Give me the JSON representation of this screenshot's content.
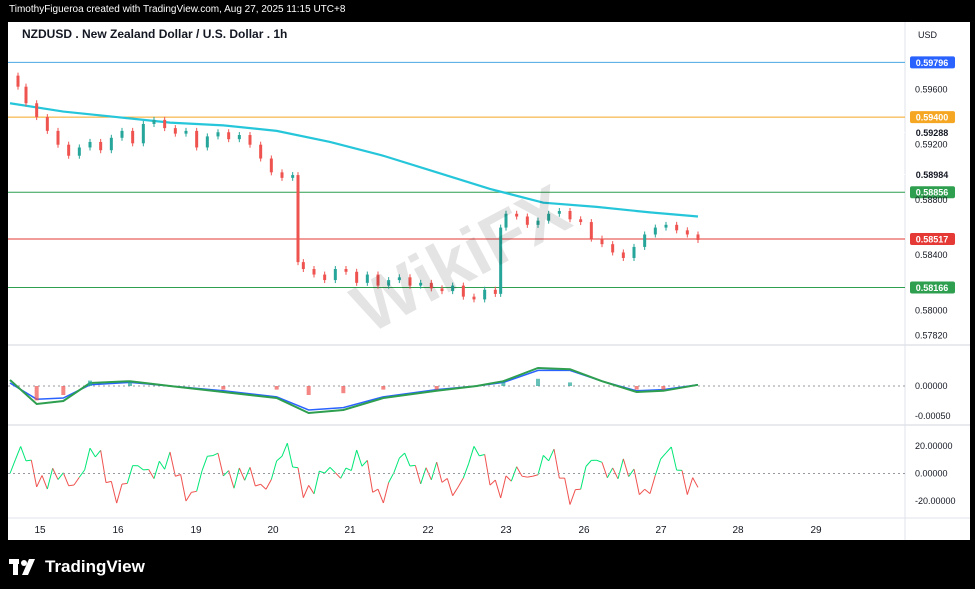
{
  "header": {
    "credit": "TimothyFigueroa created with TradingView.com, Aug 27, 2025 11:15 UTC+8"
  },
  "footer": {
    "brand": "TradingView"
  },
  "watermark": {
    "text": "WikiFX"
  },
  "chart_data": {
    "type": "line",
    "title": "NZDUSD . New Zealand Dollar / U.S. Dollar . 1h",
    "currency": "USD",
    "x_labels": [
      "15",
      "16",
      "19",
      "20",
      "21",
      "22",
      "23",
      "26",
      "27",
      "28",
      "29"
    ],
    "price_ticks": [
      "0.59600",
      "0.59200",
      "0.58800",
      "0.58400",
      "0.58000",
      "0.57820"
    ],
    "horizontal_levels": [
      {
        "value": "0.59796",
        "color": "#2962ff",
        "line": "#4aa8e0"
      },
      {
        "value": "0.59400",
        "color": "#f5a623",
        "line": "#f5a623"
      },
      {
        "value": "0.59288",
        "color": "#ffffff",
        "line": "#ffffff"
      },
      {
        "value": "0.58984",
        "color": "#ffffff",
        "line": "#ffffff"
      },
      {
        "value": "0.58856",
        "color": "#2e9e4f",
        "line": "#2e9e4f"
      },
      {
        "value": "0.58528",
        "color": "#ffffff",
        "line": "#ffffff"
      },
      {
        "value": "0.58517",
        "color": "#e53935",
        "line": "#e53935"
      },
      {
        "value": "0.58166",
        "color": "#2e9e4f",
        "line": "#2e9e4f"
      }
    ],
    "price_path": [
      [
        0,
        0.597
      ],
      [
        3,
        0.5962
      ],
      [
        6,
        0.595
      ],
      [
        10,
        0.594
      ],
      [
        14,
        0.593
      ],
      [
        18,
        0.592
      ],
      [
        22,
        0.5912
      ],
      [
        26,
        0.5918
      ],
      [
        30,
        0.5922
      ],
      [
        34,
        0.5916
      ],
      [
        38,
        0.5925
      ],
      [
        42,
        0.593
      ],
      [
        46,
        0.5921
      ],
      [
        50,
        0.5935
      ],
      [
        54,
        0.5938
      ],
      [
        58,
        0.5932
      ],
      [
        62,
        0.5928
      ],
      [
        66,
        0.593
      ],
      [
        70,
        0.5918
      ],
      [
        74,
        0.5926
      ],
      [
        78,
        0.5929
      ],
      [
        82,
        0.5924
      ],
      [
        86,
        0.5927
      ],
      [
        90,
        0.592
      ],
      [
        94,
        0.591
      ],
      [
        98,
        0.59
      ],
      [
        102,
        0.5896
      ],
      [
        106,
        0.5898
      ],
      [
        108,
        0.5835
      ],
      [
        110,
        0.583
      ],
      [
        114,
        0.5826
      ],
      [
        118,
        0.5822
      ],
      [
        122,
        0.583
      ],
      [
        126,
        0.5828
      ],
      [
        130,
        0.582
      ],
      [
        134,
        0.5826
      ],
      [
        138,
        0.5818
      ],
      [
        142,
        0.5822
      ],
      [
        146,
        0.5824
      ],
      [
        150,
        0.5818
      ],
      [
        154,
        0.582
      ],
      [
        158,
        0.5816
      ],
      [
        162,
        0.5814
      ],
      [
        166,
        0.5818
      ],
      [
        170,
        0.581
      ],
      [
        174,
        0.5808
      ],
      [
        178,
        0.5815
      ],
      [
        182,
        0.5812
      ],
      [
        184,
        0.586
      ],
      [
        186,
        0.587
      ],
      [
        190,
        0.5868
      ],
      [
        194,
        0.5862
      ],
      [
        198,
        0.5865
      ],
      [
        202,
        0.587
      ],
      [
        206,
        0.5872
      ],
      [
        210,
        0.5866
      ],
      [
        214,
        0.5864
      ],
      [
        218,
        0.5852
      ],
      [
        222,
        0.5848
      ],
      [
        226,
        0.5842
      ],
      [
        230,
        0.5838
      ],
      [
        234,
        0.5846
      ],
      [
        238,
        0.5855
      ],
      [
        242,
        0.586
      ],
      [
        246,
        0.5862
      ],
      [
        250,
        0.5858
      ],
      [
        254,
        0.5855
      ],
      [
        258,
        0.5851
      ]
    ],
    "ma_path": [
      [
        0,
        0.595
      ],
      [
        20,
        0.5944
      ],
      [
        40,
        0.594
      ],
      [
        60,
        0.5936
      ],
      [
        80,
        0.5934
      ],
      [
        100,
        0.593
      ],
      [
        120,
        0.5922
      ],
      [
        140,
        0.5912
      ],
      [
        160,
        0.59
      ],
      [
        180,
        0.5888
      ],
      [
        200,
        0.5878
      ],
      [
        220,
        0.5875
      ],
      [
        240,
        0.5871
      ],
      [
        258,
        0.5868
      ]
    ],
    "macd": {
      "ticks": [
        "0.00000",
        "-0.00050"
      ],
      "fast": [
        [
          0,
          0.0001
        ],
        [
          10,
          -0.0003
        ],
        [
          20,
          -0.00025
        ],
        [
          30,
          5e-05
        ],
        [
          45,
          8e-05
        ],
        [
          60,
          0.0
        ],
        [
          80,
          -0.0001
        ],
        [
          100,
          -0.0002
        ],
        [
          112,
          -0.00045
        ],
        [
          125,
          -0.0004
        ],
        [
          140,
          -0.0002
        ],
        [
          160,
          -8e-05
        ],
        [
          175,
          0.0
        ],
        [
          185,
          8e-05
        ],
        [
          198,
          0.0003
        ],
        [
          210,
          0.00028
        ],
        [
          222,
          8e-05
        ],
        [
          235,
          -0.0001
        ],
        [
          245,
          -8e-05
        ],
        [
          258,
          2e-05
        ]
      ],
      "slow": [
        [
          0,
          5e-05
        ],
        [
          10,
          -0.00022
        ],
        [
          20,
          -0.0002
        ],
        [
          30,
          2e-05
        ],
        [
          45,
          6e-05
        ],
        [
          60,
          0.0
        ],
        [
          80,
          -8e-05
        ],
        [
          100,
          -0.00018
        ],
        [
          112,
          -0.0004
        ],
        [
          125,
          -0.00036
        ],
        [
          140,
          -0.00018
        ],
        [
          160,
          -6e-05
        ],
        [
          175,
          0.0
        ],
        [
          185,
          6e-05
        ],
        [
          198,
          0.00026
        ],
        [
          210,
          0.00026
        ],
        [
          222,
          8e-05
        ],
        [
          235,
          -8e-05
        ],
        [
          245,
          -6e-05
        ],
        [
          258,
          2e-05
        ]
      ]
    },
    "rsi": {
      "ticks": [
        "20.00000",
        "0.00000",
        "-20.00000"
      ]
    }
  }
}
